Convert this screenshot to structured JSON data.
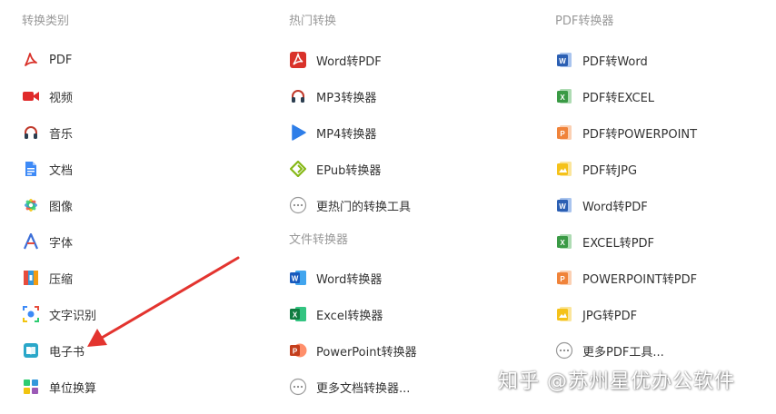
{
  "columns": [
    {
      "title": "转换类别",
      "items": [
        {
          "label": "PDF",
          "icon": "pdf-logo-icon"
        },
        {
          "label": "视频",
          "icon": "video-camera-icon"
        },
        {
          "label": "音乐",
          "icon": "headphones-icon"
        },
        {
          "label": "文档",
          "icon": "document-icon"
        },
        {
          "label": "图像",
          "icon": "image-flower-icon"
        },
        {
          "label": "字体",
          "icon": "font-icon"
        },
        {
          "label": "压缩",
          "icon": "archive-icon"
        },
        {
          "label": "文字识别",
          "icon": "ocr-scan-icon"
        },
        {
          "label": "电子书",
          "icon": "ebook-icon"
        },
        {
          "label": "单位换算",
          "icon": "unit-convert-icon"
        }
      ]
    },
    {
      "sections": [
        {
          "title": "热门转换",
          "items": [
            {
              "label": "Word转PDF",
              "icon": "pdf-logo-icon"
            },
            {
              "label": "MP3转换器",
              "icon": "headphones-icon"
            },
            {
              "label": "MP4转换器",
              "icon": "play-icon"
            },
            {
              "label": "EPub转换器",
              "icon": "epub-icon"
            },
            {
              "label": "更热门的转换工具",
              "icon": "more-dots-icon"
            }
          ]
        },
        {
          "title": "文件转换器",
          "items": [
            {
              "label": "Word转换器",
              "icon": "word-icon"
            },
            {
              "label": "Excel转换器",
              "icon": "excel-icon"
            },
            {
              "label": "PowerPoint转换器",
              "icon": "powerpoint-icon"
            },
            {
              "label": "更多文档转换器...",
              "icon": "more-dots-icon"
            }
          ]
        }
      ]
    },
    {
      "title": "PDF转换器",
      "items": [
        {
          "label": "PDF转Word",
          "icon": "word-doc-icon"
        },
        {
          "label": "PDF转EXCEL",
          "icon": "excel-doc-icon"
        },
        {
          "label": "PDF转POWERPOINT",
          "icon": "ppt-doc-icon"
        },
        {
          "label": "PDF转JPG",
          "icon": "jpg-doc-icon"
        },
        {
          "label": "Word转PDF",
          "icon": "word-doc-icon"
        },
        {
          "label": "EXCEL转PDF",
          "icon": "excel-doc-icon"
        },
        {
          "label": "POWERPOINT转PDF",
          "icon": "ppt-doc-icon"
        },
        {
          "label": "JPG转PDF",
          "icon": "jpg-doc-icon"
        },
        {
          "label": "更多PDF工具...",
          "icon": "more-dots-icon"
        }
      ]
    }
  ],
  "watermark": "知乎 @苏州星优办公软件",
  "colors": {
    "title": "#999999",
    "text": "#333333",
    "pdf_red": "#d9322a",
    "word_blue": "#2b5fb3",
    "excel_green": "#3a9a45",
    "ppt_orange": "#f0833a",
    "jpg_yellow": "#f5c21a",
    "arrow_red": "#e3342f"
  }
}
